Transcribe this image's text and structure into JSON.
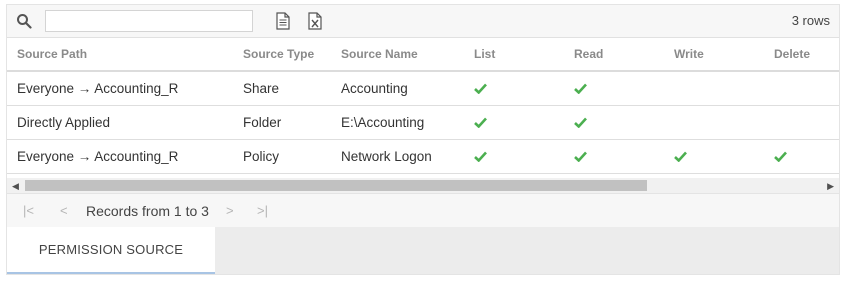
{
  "toolbar": {
    "search_value": "",
    "search_placeholder": "",
    "rows_label": "3 rows",
    "icons": [
      "search-icon",
      "export-document-icon",
      "export-excel-icon"
    ]
  },
  "grid": {
    "columns": [
      "Source Path",
      "Source Type",
      "Source Name",
      "List",
      "Read",
      "Write",
      "Delete"
    ],
    "rows": [
      {
        "path": "Everyone → Accounting_R",
        "type": "Share",
        "name": "Accounting",
        "list": true,
        "read": true,
        "write": false,
        "delete": false
      },
      {
        "path": "Directly Applied",
        "type": "Folder",
        "name": "E:\\Accounting",
        "list": true,
        "read": true,
        "write": false,
        "delete": false
      },
      {
        "path": "Everyone → Accounting_R",
        "type": "Policy",
        "name": "Network Logon",
        "list": true,
        "read": true,
        "write": true,
        "delete": true
      }
    ],
    "check_color": "#4caf50"
  },
  "pager": {
    "label": "Records from 1 to 3",
    "first": "|<",
    "prev": "<",
    "next": ">",
    "last": ">|"
  },
  "tabs": [
    {
      "label": "PERMISSION SOURCE",
      "active": true
    }
  ]
}
